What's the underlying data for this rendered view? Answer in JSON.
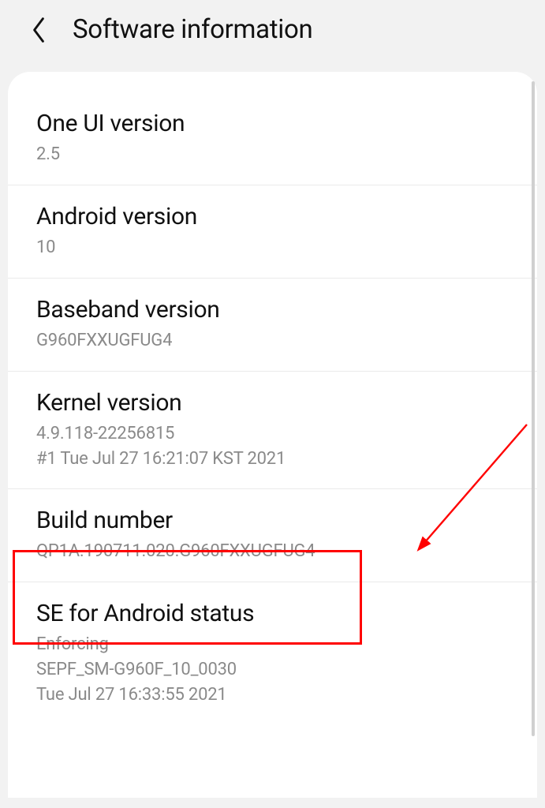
{
  "header": {
    "title": "Software information"
  },
  "items": [
    {
      "title": "One UI version",
      "lines": [
        "2.5"
      ]
    },
    {
      "title": "Android version",
      "lines": [
        "10"
      ]
    },
    {
      "title": "Baseband version",
      "lines": [
        "G960FXXUGFUG4"
      ]
    },
    {
      "title": "Kernel version",
      "lines": [
        "4.9.118-22256815",
        "#1 Tue Jul 27 16:21:07 KST 2021"
      ]
    },
    {
      "title": "Build number",
      "lines": [
        "QP1A.190711.020.G960FXXUGFUG4"
      ]
    },
    {
      "title": "SE for Android status",
      "lines": [
        "Enforcing",
        "SEPF_SM-G960F_10_0030",
        "Tue Jul 27 16:33:55 2021"
      ]
    }
  ],
  "annotation": {
    "highlight_index": 4
  }
}
